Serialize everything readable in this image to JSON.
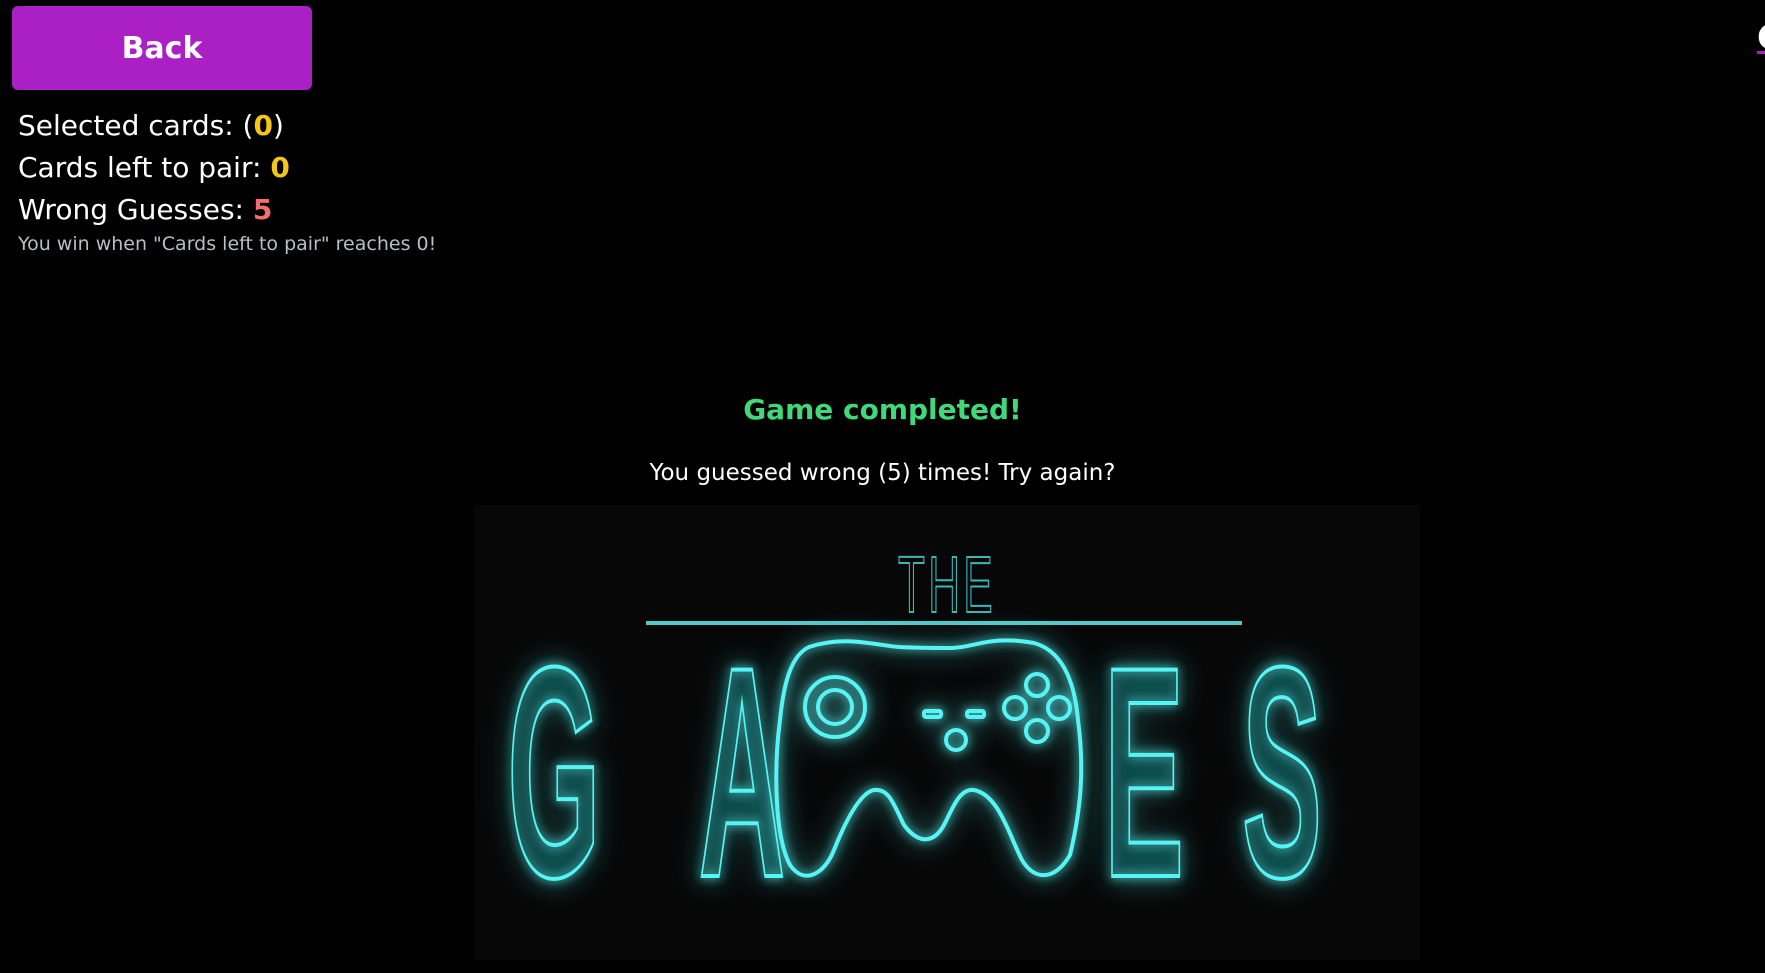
{
  "back_button": {
    "label": "Back"
  },
  "stats": {
    "selected_label": "Selected cards: (",
    "selected_value": "0",
    "selected_suffix": ")",
    "left_label": "Cards left to pair: ",
    "left_value": "0",
    "wrong_label": "Wrong Guesses: ",
    "wrong_value": "5",
    "hint": "You win when \"Cards left to pair\" reaches 0!"
  },
  "corner_link": {
    "label": "G"
  },
  "result": {
    "title": "Game completed!",
    "message": "You guessed wrong (5) times! Try again?"
  },
  "logo": {
    "top_text": "THE",
    "letters": [
      "G",
      "A",
      "E",
      "S"
    ],
    "glow_color": "#3ff2f2"
  },
  "colors": {
    "background": "#000000",
    "button": "#ab20c4",
    "success": "#3fd97a",
    "highlight": "#f5c518",
    "wrong": "#f26d6d"
  }
}
